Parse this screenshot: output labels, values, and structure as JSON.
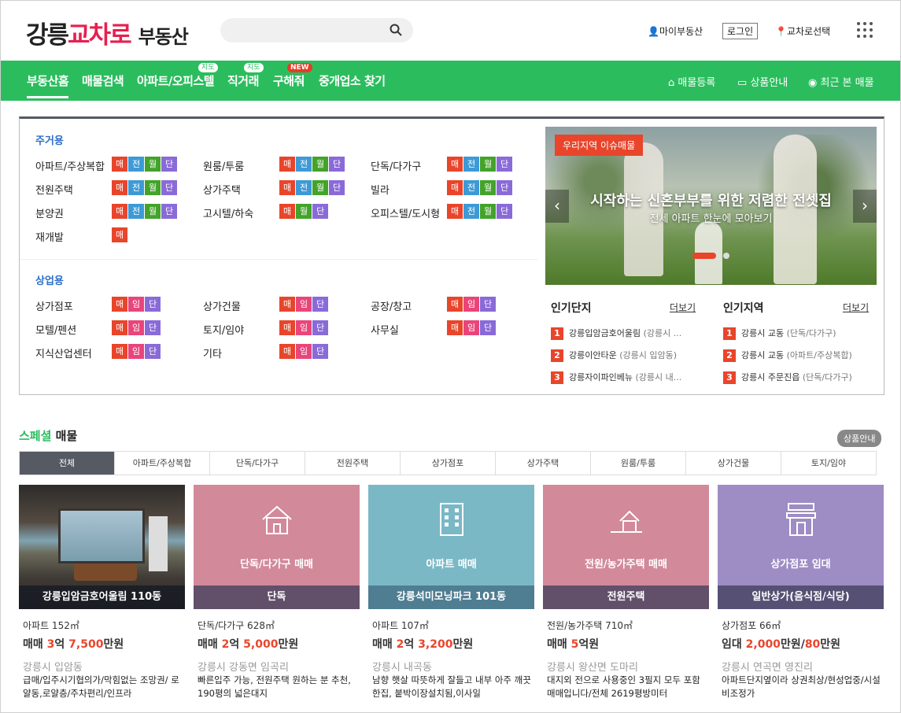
{
  "header": {
    "logo1": "강릉",
    "logo2": "교차로",
    "logo3": "부동산",
    "my": "마이부동산",
    "login": "로그인",
    "region": "교차로선택"
  },
  "nav": {
    "items": [
      "부동산홈",
      "매물검색",
      "아파트/오피스텔",
      "직거래",
      "구해줘",
      "중개업소 찾기"
    ],
    "tag_map": "지도",
    "tag_new": "NEW",
    "right": [
      "매물등록",
      "상품안내",
      "최근 본 매물"
    ]
  },
  "categories": {
    "residential_title": "주거용",
    "residential": [
      {
        "label": "아파트/주상복합",
        "badges": [
          "매",
          "전",
          "월",
          "단"
        ]
      },
      {
        "label": "원룸/투룸",
        "badges": [
          "매",
          "전",
          "월",
          "단"
        ]
      },
      {
        "label": "단독/다가구",
        "badges": [
          "매",
          "전",
          "월",
          "단"
        ]
      },
      {
        "label": "전원주택",
        "badges": [
          "매",
          "전",
          "월",
          "단"
        ]
      },
      {
        "label": "상가주택",
        "badges": [
          "매",
          "전",
          "월",
          "단"
        ]
      },
      {
        "label": "빌라",
        "badges": [
          "매",
          "전",
          "월",
          "단"
        ]
      },
      {
        "label": "분양권",
        "badges": [
          "매",
          "전",
          "월",
          "단"
        ]
      },
      {
        "label": "고시텔/하숙",
        "badges": [
          "매",
          "월",
          "단"
        ]
      },
      {
        "label": "오피스텔/도시형",
        "badges": [
          "매",
          "전",
          "월",
          "단"
        ]
      },
      {
        "label": "재개발",
        "badges": [
          "매"
        ]
      }
    ],
    "commercial_title": "상업용",
    "commercial": [
      {
        "label": "상가점포",
        "badges": [
          "매",
          "임",
          "단"
        ]
      },
      {
        "label": "상가건물",
        "badges": [
          "매",
          "임",
          "단"
        ]
      },
      {
        "label": "공장/창고",
        "badges": [
          "매",
          "임",
          "단"
        ]
      },
      {
        "label": "모텔/펜션",
        "badges": [
          "매",
          "임",
          "단"
        ]
      },
      {
        "label": "토지/임야",
        "badges": [
          "매",
          "임",
          "단"
        ]
      },
      {
        "label": "사무실",
        "badges": [
          "매",
          "임",
          "단"
        ]
      },
      {
        "label": "지식산업센터",
        "badges": [
          "매",
          "임",
          "단"
        ]
      },
      {
        "label": "기타",
        "badges": [
          "매",
          "임",
          "단"
        ]
      }
    ]
  },
  "banner": {
    "tag": "우리지역 이슈매물",
    "title": "시작하는 신혼부부를 위한 저렴한 전셋집",
    "subtitle": "전세 아파트 한눈에 모아보기"
  },
  "popular": {
    "complex_title": "인기단지",
    "region_title": "인기지역",
    "more": "더보기",
    "complex": [
      {
        "n": "1",
        "name": "강릉입암금호어울림",
        "sub": "(강릉시 ..."
      },
      {
        "n": "2",
        "name": "강릉이안타운",
        "sub": "(강릉시 입암동)"
      },
      {
        "n": "3",
        "name": "강릉자이파인베뉴",
        "sub": "(강릉시 내..."
      }
    ],
    "region": [
      {
        "n": "1",
        "name": "강릉시 교동",
        "sub": "(단독/다가구)"
      },
      {
        "n": "2",
        "name": "강릉시 교동",
        "sub": "(아파트/주상복합)"
      },
      {
        "n": "3",
        "name": "강릉시 주문진읍",
        "sub": "(단독/다가구)"
      }
    ]
  },
  "special": {
    "title_g": "스페셜",
    "title": "매물",
    "info": "상품안내",
    "tabs": [
      "전체",
      "아파트/주상복합",
      "단독/다가구",
      "전원주택",
      "상가점포",
      "상가주택",
      "원룸/투룸",
      "상가건물",
      "토지/임야"
    ]
  },
  "cards": [
    {
      "overlay": "",
      "caption": "강릉입암금호어울림 110동",
      "color": "#1e2a3a",
      "type": "아파트 152㎡",
      "price_pre": "매매 ",
      "p1": "3",
      "u1": "억 ",
      "p2": "7,500",
      "u2": "만원",
      "p3": "",
      "u3": "",
      "loc": "강릉시 입암동",
      "desc": "급매/입주시기협의가/막힘없는 조망권/ 로얄동,로얄층/주차편리/인프라"
    },
    {
      "overlay": "단독/다가구 매매",
      "caption": "단독",
      "color": "#d2899a",
      "type": "단독/다가구 628㎡",
      "price_pre": "매매 ",
      "p1": "2",
      "u1": "억 ",
      "p2": "5,000",
      "u2": "만원",
      "p3": "",
      "u3": "",
      "loc": "강릉시 강동면 임곡리",
      "desc": "빠른입주 가능, 전원주택 원하는 분 추천, 190평의 넓은대지"
    },
    {
      "overlay": "아파트 매매",
      "caption": "강릉석미모닝파크 101동",
      "color": "#7ab8c6",
      "type": "아파트 107㎡",
      "price_pre": "매매 ",
      "p1": "2",
      "u1": "억 ",
      "p2": "3,200",
      "u2": "만원",
      "p3": "",
      "u3": "",
      "loc": "강릉시 내곡동",
      "desc": "남향 햇살 따뜻하게 잘들고 내부 아주 깨끗한집, 붙박이장설치됨,이사일"
    },
    {
      "overlay": "전원/농가주택 매매",
      "caption": "전원주택",
      "color": "#d2899a",
      "type": "전원/농가주택 710㎡",
      "price_pre": "매매 ",
      "p1": "5",
      "u1": "억원",
      "p2": "",
      "u2": "",
      "p3": "",
      "u3": "",
      "loc": "강릉시 왕산면 도마리",
      "desc": "대지외 전으로 사용중인 3필지 모두 포함 매매입니다/전체 2619평방미터"
    },
    {
      "overlay": "상가점포 임대",
      "caption": "일반상가(음식점/식당)",
      "color": "#9e8cc4",
      "type": "상가점포 66㎡",
      "price_pre": "임대 ",
      "p1": "2,000",
      "u1": "만원/",
      "p2": "80",
      "u2": "만원",
      "p3": "",
      "u3": "",
      "loc": "강릉시 연곡면 영진리",
      "desc": "아파트단지옆이라 상권최상/현성업중/시설비조정가"
    }
  ],
  "colors": {
    "green": "#2bbd5d",
    "red": "#e8452b",
    "brand": "#e6204f"
  }
}
